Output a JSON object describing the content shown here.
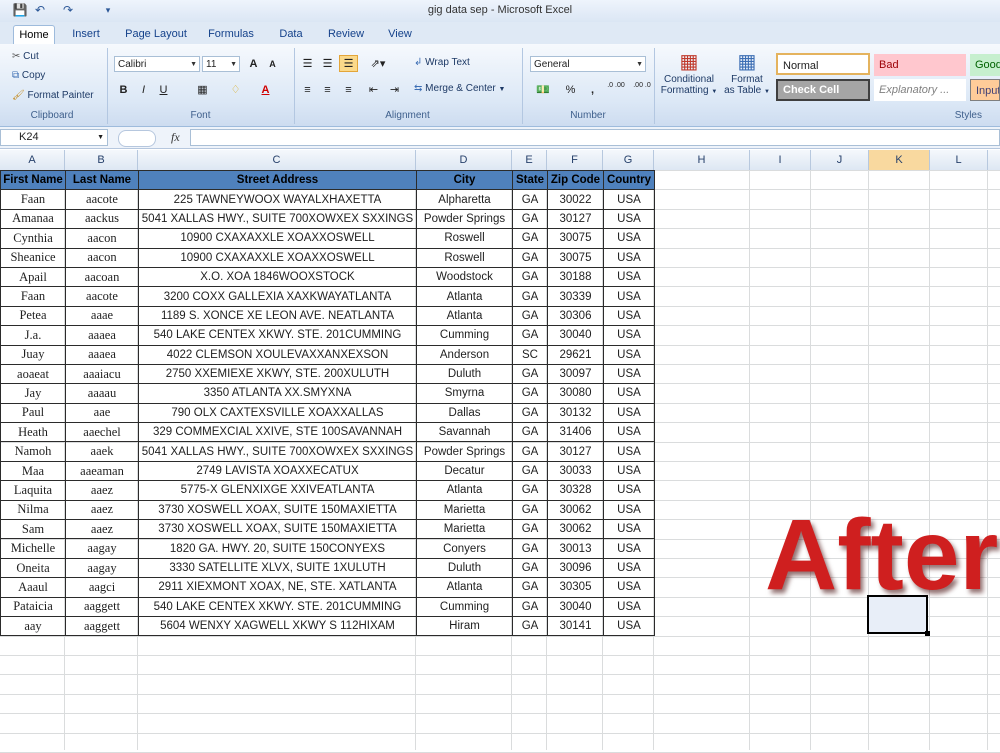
{
  "window": {
    "title": "gig data sep - Microsoft Excel"
  },
  "tabs": [
    "Home",
    "Insert",
    "Page Layout",
    "Formulas",
    "Data",
    "Review",
    "View"
  ],
  "active_tab": "Home",
  "ribbon": {
    "clipboard": {
      "label": "Clipboard",
      "cut": "Cut",
      "copy": "Copy",
      "format_painter": "Format Painter"
    },
    "font": {
      "label": "Font",
      "name": "Calibri",
      "size": "11",
      "grow": "A",
      "shrink": "A",
      "bold": "B",
      "italic": "I",
      "underline": "U"
    },
    "alignment": {
      "label": "Alignment",
      "wrap_text": "Wrap Text",
      "merge_center": "Merge & Center"
    },
    "number": {
      "label": "Number",
      "format": "General",
      "percent": "%",
      "comma": ",",
      "inc_decimal": ".0 .00",
      "dec_decimal": ".00 .0"
    },
    "styles": {
      "label": "Styles",
      "conditional_formatting": [
        "Conditional",
        "Formatting"
      ],
      "format_as_table": [
        "Format",
        "as Table"
      ],
      "normal": "Normal",
      "bad": "Bad",
      "good": "Good",
      "check_cell": "Check Cell",
      "explanatory": "Explanatory ...",
      "input": "Input"
    }
  },
  "formula_bar": {
    "name_box": "K24",
    "fx": "fx",
    "value": ""
  },
  "columns": [
    "A",
    "B",
    "C",
    "D",
    "E",
    "F",
    "G",
    "H",
    "I",
    "J",
    "K",
    "L"
  ],
  "selected_column": "K",
  "table": {
    "headers": [
      "First Name",
      "Last Name",
      "Street Address",
      "City",
      "State",
      "Zip Code",
      "Country"
    ],
    "rows": [
      [
        "Faan",
        "aacote",
        "225 TAWNEYWOOX WAYALXHAXETTA",
        "Alpharetta",
        "GA",
        "30022",
        "USA"
      ],
      [
        "Amanaa",
        "aackus",
        "5041 XALLAS HWY., SUITE 700XOWXEX SXXINGS",
        "Powder Springs",
        "GA",
        "30127",
        "USA"
      ],
      [
        "Cynthia",
        "aacon",
        "10900 CXAXAXXLE XOAXXOSWELL",
        "Roswell",
        "GA",
        "30075",
        "USA"
      ],
      [
        "Sheanice",
        "aacon",
        "10900 CXAXAXXLE XOAXXOSWELL",
        "Roswell",
        "GA",
        "30075",
        "USA"
      ],
      [
        "Apail",
        "aacoan",
        "X.O. XOA 1846WOOXSTOCK",
        "Woodstock",
        "GA",
        "30188",
        "USA"
      ],
      [
        "Faan",
        "aacote",
        "3200 COXX GALLEXIA XAXKWAYATLANTA",
        "Atlanta",
        "GA",
        "30339",
        "USA"
      ],
      [
        "Petea",
        "aaae",
        "1189 S. XONCE XE LEON AVE. NEATLANTA",
        "Atlanta",
        "GA",
        "30306",
        "USA"
      ],
      [
        "J.a.",
        "aaaea",
        "540 LAKE CENTEX XKWY. STE. 201CUMMING",
        "Cumming",
        "GA",
        "30040",
        "USA"
      ],
      [
        "Juay",
        "aaaea",
        "4022 CLEMSON XOULEVAXXANXEXSON",
        "Anderson",
        "SC",
        "29621",
        "USA"
      ],
      [
        "aoaeat",
        "aaaiacu",
        "2750 XXEMIEXE XKWY, STE. 200XULUTH",
        "Duluth",
        "GA",
        "30097",
        "USA"
      ],
      [
        "Jay",
        "aaaau",
        "3350 ATLANTA XX.SMYXNA",
        "Smyrna",
        "GA",
        "30080",
        "USA"
      ],
      [
        "Paul",
        "aae",
        "790 OLX CAXTEXSVILLE XOAXXALLAS",
        "Dallas",
        "GA",
        "30132",
        "USA"
      ],
      [
        "Heath",
        "aaechel",
        "329 COMMEXCIAL XXIVE, STE 100SAVANNAH",
        "Savannah",
        "GA",
        "31406",
        "USA"
      ],
      [
        "Namoh",
        "aaek",
        "5041 XALLAS HWY., SUITE 700XOWXEX SXXINGS",
        "Powder Springs",
        "GA",
        "30127",
        "USA"
      ],
      [
        "Maa",
        "aaeaman",
        "2749 LAVISTA XOAXXECATUX",
        "Decatur",
        "GA",
        "30033",
        "USA"
      ],
      [
        "Laquita",
        "aaez",
        "5775-X GLENXIXGE XXIVEATLANTA",
        "Atlanta",
        "GA",
        "30328",
        "USA"
      ],
      [
        "Nilma",
        "aaez",
        "3730 XOSWELL XOAX, SUITE 150MAXIETTA",
        "Marietta",
        "GA",
        "30062",
        "USA"
      ],
      [
        "Sam",
        "aaez",
        "3730 XOSWELL XOAX, SUITE 150MAXIETTA",
        "Marietta",
        "GA",
        "30062",
        "USA"
      ],
      [
        "Michelle",
        "aagay",
        "1820 GA. HWY. 20, SUITE 150CONYEXS",
        "Conyers",
        "GA",
        "30013",
        "USA"
      ],
      [
        "Oneita",
        "aagay",
        "3330 SATELLITE XLVX, SUITE 1XULUTH",
        "Duluth",
        "GA",
        "30096",
        "USA"
      ],
      [
        "Aaaul",
        "aagci",
        "2911 XIEXMONT XOAX, NE, STE. XATLANTA",
        "Atlanta",
        "GA",
        "30305",
        "USA"
      ],
      [
        "Pataicia",
        "aaggett",
        "540 LAKE CENTEX XKWY. STE. 201CUMMING",
        "Cumming",
        "GA",
        "30040",
        "USA"
      ],
      [
        "aay",
        "aaggett",
        "5604 WENXY XAGWELL XKWY S 112HIXAM",
        "Hiram",
        "GA",
        "30141",
        "USA"
      ]
    ]
  },
  "overlay_text": "After",
  "colors": {
    "header_fill": "#4f81bd",
    "overlay": "#cf1f1f",
    "accent": "#15428b"
  }
}
